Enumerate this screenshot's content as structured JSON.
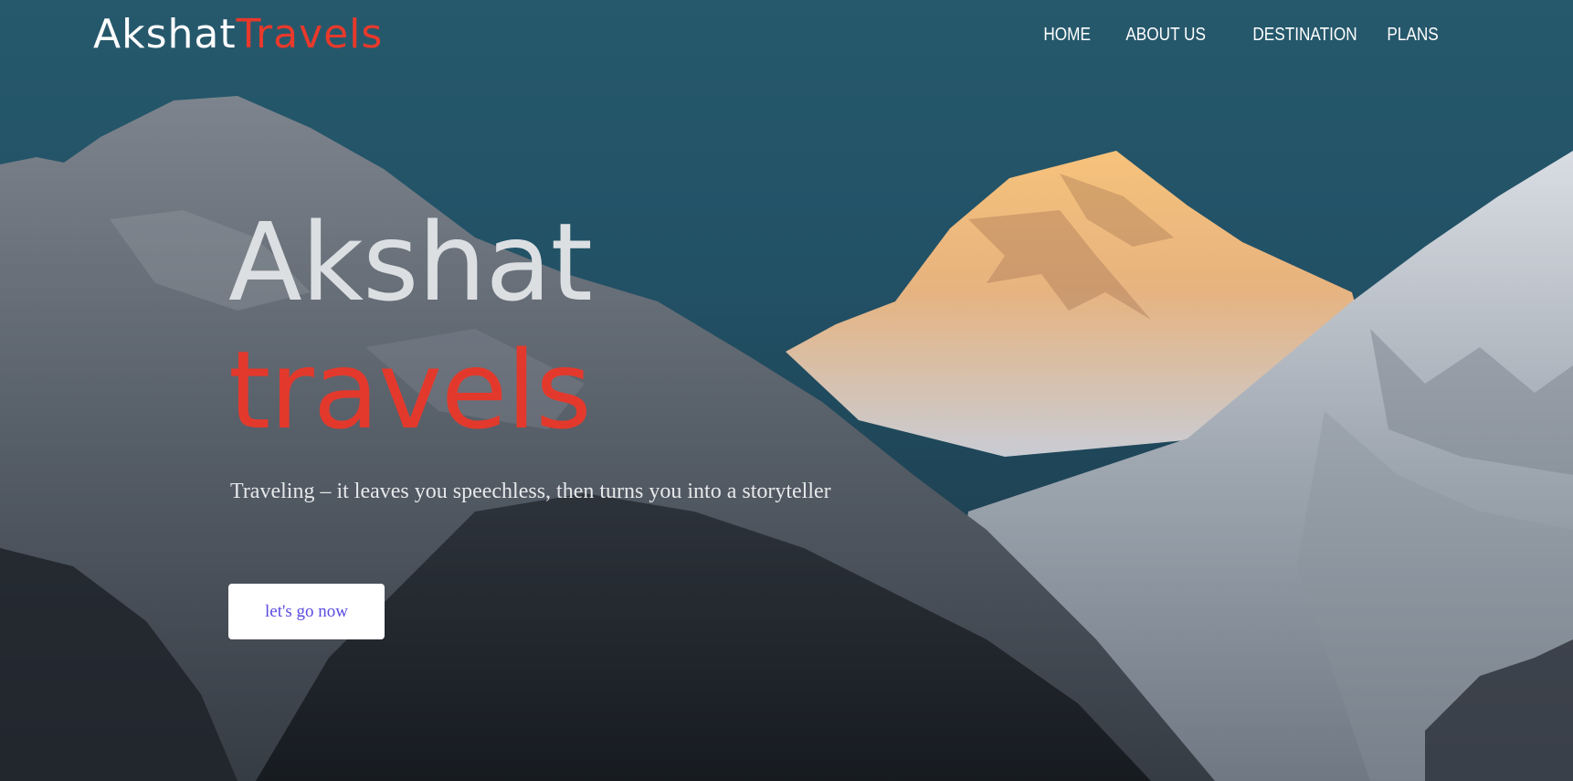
{
  "brand": {
    "name_part1": "Akshat",
    "name_part2": "Travels",
    "accent_color": "#e8392b"
  },
  "nav": {
    "items": [
      {
        "label": "HOME"
      },
      {
        "label": "ABOUT US"
      },
      {
        "label": "DESTINATION"
      },
      {
        "label": "PLANS"
      }
    ]
  },
  "hero": {
    "title_line1": "Akshat",
    "title_line2": "travels",
    "tagline": "Traveling – it leaves you speechless, then turns you into a storyteller",
    "cta_label": "let's go now",
    "cta_text_color": "#5b4be0"
  }
}
